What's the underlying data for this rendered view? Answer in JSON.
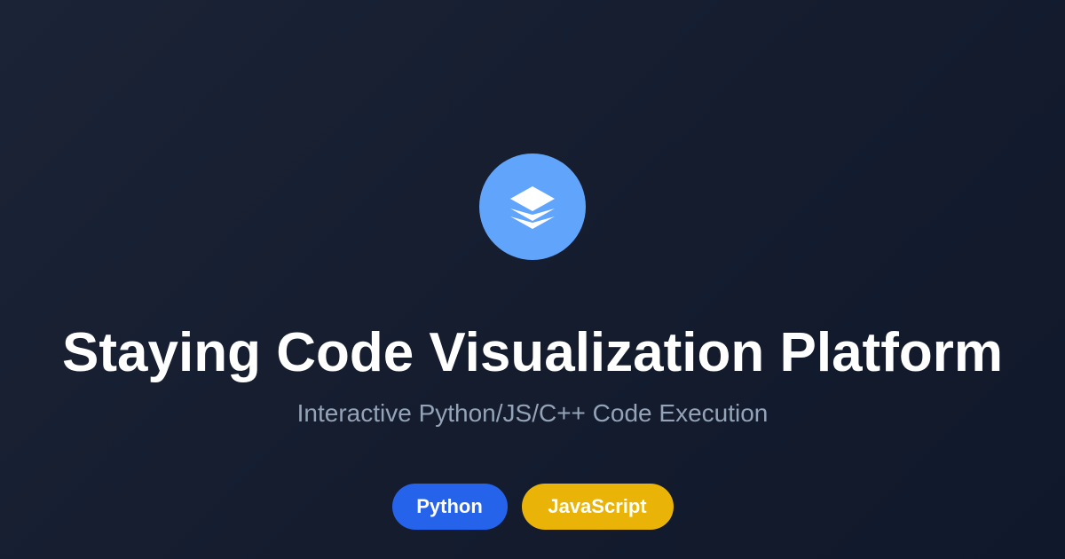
{
  "brand": {
    "logo_icon": "layers-icon",
    "logo_background": "#61a4fb"
  },
  "hero": {
    "title": "Staying Code Visualization Platform",
    "subtitle": "Interactive Python/JS/C++ Code Execution"
  },
  "tags": [
    {
      "label": "Python",
      "color": "#2563eb"
    },
    {
      "label": "JavaScript",
      "color": "#eab308"
    }
  ],
  "colors": {
    "background": "#161f31",
    "title": "#ffffff",
    "subtitle": "#94a3b8"
  }
}
